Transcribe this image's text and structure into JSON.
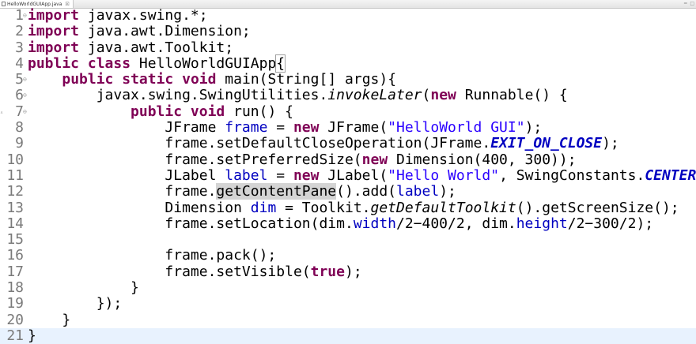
{
  "tab": {
    "title": "HelloWorldGUIApp.java",
    "close": "☒"
  },
  "window_controls": {
    "minimize": "=",
    "maximize": "□"
  },
  "colors": {
    "keyword": "#7f0055",
    "string": "#2a00ff",
    "field": "#0000c0",
    "current_line": "#e8f2fe",
    "occurrence_highlight": "#d4d4d4",
    "line_number": "#7a7a7a"
  },
  "editor": {
    "current_line": 21,
    "lines": [
      {
        "n": "1",
        "fold": "⊖",
        "tokens": [
          {
            "t": "import",
            "c": "kw"
          },
          {
            "t": " javax.swing.*;"
          }
        ]
      },
      {
        "n": "2",
        "tokens": [
          {
            "t": "import",
            "c": "kw"
          },
          {
            "t": " java.awt.Dimension;"
          }
        ]
      },
      {
        "n": "3",
        "tokens": [
          {
            "t": "import",
            "c": "kw"
          },
          {
            "t": " java.awt.Toolkit;"
          }
        ]
      },
      {
        "n": "4",
        "tokens": [
          {
            "t": "public",
            "c": "kw"
          },
          {
            "t": " "
          },
          {
            "t": "class",
            "c": "kw"
          },
          {
            "t": " HelloWorldGUIApp"
          },
          {
            "t": "{",
            "c": "bracket"
          }
        ]
      },
      {
        "n": "5",
        "fold": "⊖",
        "tokens": [
          {
            "t": "    "
          },
          {
            "t": "public",
            "c": "kw"
          },
          {
            "t": " "
          },
          {
            "t": "static",
            "c": "kw"
          },
          {
            "t": " "
          },
          {
            "t": "void",
            "c": "kw"
          },
          {
            "t": " main(String[] args){"
          }
        ]
      },
      {
        "n": "6",
        "fold": "⊖",
        "tokens": [
          {
            "t": "        javax.swing.SwingUtilities."
          },
          {
            "t": "invokeLater",
            "c": "smeth"
          },
          {
            "t": "("
          },
          {
            "t": "new",
            "c": "kw"
          },
          {
            "t": " Runnable() {"
          }
        ]
      },
      {
        "n": "7",
        "fold": "⊖",
        "arrow": "▵",
        "tokens": [
          {
            "t": "            "
          },
          {
            "t": "public",
            "c": "kw"
          },
          {
            "t": " "
          },
          {
            "t": "void",
            "c": "kw"
          },
          {
            "t": " run() {"
          }
        ]
      },
      {
        "n": "8",
        "tokens": [
          {
            "t": "                JFrame "
          },
          {
            "t": "frame",
            "c": "fld"
          },
          {
            "t": " = "
          },
          {
            "t": "new",
            "c": "kw"
          },
          {
            "t": " JFrame("
          },
          {
            "t": "\"HelloWorld GUI\"",
            "c": "str"
          },
          {
            "t": ");"
          }
        ]
      },
      {
        "n": "9",
        "tokens": [
          {
            "t": "                frame.setDefaultCloseOperation(JFrame."
          },
          {
            "t": "EXIT_ON_CLOSE",
            "c": "sfld"
          },
          {
            "t": ");"
          }
        ]
      },
      {
        "n": "10",
        "tokens": [
          {
            "t": "                frame.setPreferredSize("
          },
          {
            "t": "new",
            "c": "kw"
          },
          {
            "t": " Dimension(400, 300));"
          }
        ]
      },
      {
        "n": "11",
        "tokens": [
          {
            "t": "                JLabel "
          },
          {
            "t": "label",
            "c": "fld"
          },
          {
            "t": " = "
          },
          {
            "t": "new",
            "c": "kw"
          },
          {
            "t": " JLabel("
          },
          {
            "t": "\"Hello World\"",
            "c": "str"
          },
          {
            "t": ", SwingConstants."
          },
          {
            "t": "CENTER",
            "c": "sfld"
          },
          {
            "t": ");"
          }
        ]
      },
      {
        "n": "12",
        "tokens": [
          {
            "t": "                frame."
          },
          {
            "t": "getContentPane",
            "c": "occ"
          },
          {
            "t": "().add("
          },
          {
            "t": "label",
            "c": "fld"
          },
          {
            "t": ");"
          }
        ]
      },
      {
        "n": "13",
        "tokens": [
          {
            "t": "                Dimension "
          },
          {
            "t": "dim",
            "c": "fld"
          },
          {
            "t": " = Toolkit."
          },
          {
            "t": "getDefaultToolkit",
            "c": "smeth"
          },
          {
            "t": "().getScreenSize();"
          }
        ]
      },
      {
        "n": "14",
        "tokens": [
          {
            "t": "                frame.setLocation(dim."
          },
          {
            "t": "width",
            "c": "fld"
          },
          {
            "t": "/2−400/2, dim."
          },
          {
            "t": "height",
            "c": "fld"
          },
          {
            "t": "/2−300/2);"
          }
        ]
      },
      {
        "n": "15",
        "tokens": [
          {
            "t": ""
          }
        ]
      },
      {
        "n": "16",
        "tokens": [
          {
            "t": "                frame.pack();"
          }
        ]
      },
      {
        "n": "17",
        "tokens": [
          {
            "t": "                frame.setVisible("
          },
          {
            "t": "true",
            "c": "kw"
          },
          {
            "t": ");"
          }
        ]
      },
      {
        "n": "18",
        "tokens": [
          {
            "t": "            }"
          }
        ]
      },
      {
        "n": "19",
        "tokens": [
          {
            "t": "        });"
          }
        ]
      },
      {
        "n": "20",
        "tokens": [
          {
            "t": "    }"
          }
        ]
      },
      {
        "n": "21",
        "tokens": [
          {
            "t": "}"
          }
        ]
      }
    ]
  }
}
